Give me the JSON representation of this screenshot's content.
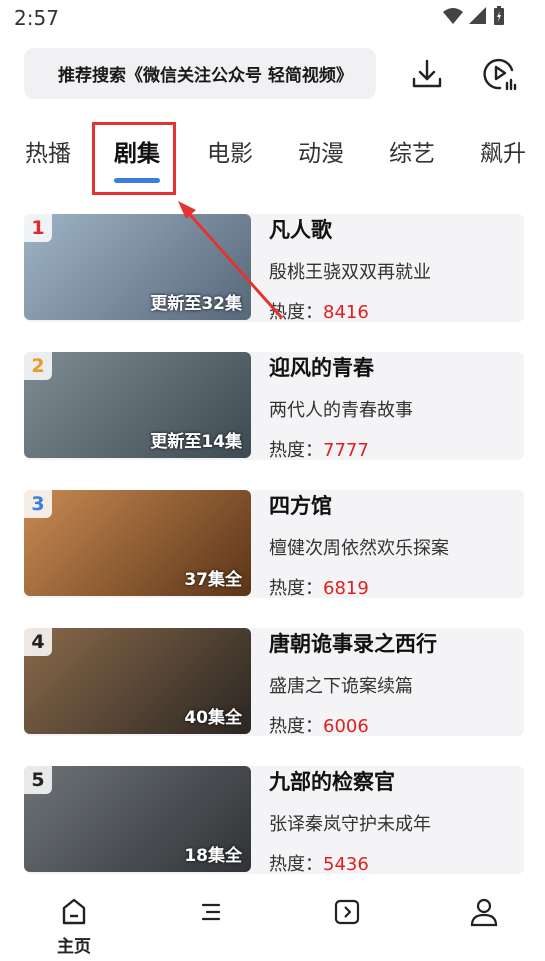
{
  "status": {
    "time": "2:57"
  },
  "search": {
    "text": "推荐搜索《微信关注公众号 轻简视频》"
  },
  "tabs": [
    {
      "label": "热播",
      "active": false
    },
    {
      "label": "剧集",
      "active": true
    },
    {
      "label": "电影",
      "active": false
    },
    {
      "label": "动漫",
      "active": false
    },
    {
      "label": "综艺",
      "active": false
    },
    {
      "label": "飙升",
      "active": false
    }
  ],
  "heat_prefix": "热度：",
  "items": [
    {
      "rank": "1",
      "rank_color": "#e02a2a",
      "episodes": "更新至32集",
      "title": "凡人歌",
      "desc": "殷桃王骁双双再就业",
      "heat": "8416",
      "thumb_colors": [
        "#9fb4c6",
        "#56687a"
      ]
    },
    {
      "rank": "2",
      "rank_color": "#e89a2a",
      "episodes": "更新至14集",
      "title": "迎风的青春",
      "desc": "两代人的青春故事",
      "heat": "7777",
      "thumb_colors": [
        "#7f8c94",
        "#3d4a52"
      ]
    },
    {
      "rank": "3",
      "rank_color": "#3b7de0",
      "episodes": "37集全",
      "title": "四方馆",
      "desc": "檀健次周依然欢乐探案",
      "heat": "6819",
      "thumb_colors": [
        "#c98b52",
        "#5a3418"
      ]
    },
    {
      "rank": "4",
      "rank_color": "#222222",
      "episodes": "40集全",
      "title": "唐朝诡事录之西行",
      "desc": "盛唐之下诡案续篇",
      "heat": "6006",
      "thumb_colors": [
        "#8a6a4a",
        "#2a2622"
      ]
    },
    {
      "rank": "5",
      "rank_color": "#222222",
      "episodes": "18集全",
      "title": "九部的检察官",
      "desc": "张译秦岚守护未成年",
      "heat": "5436",
      "thumb_colors": [
        "#6e7378",
        "#2f3336"
      ]
    }
  ],
  "bottom_nav": [
    {
      "label": "主页",
      "icon": "home-icon",
      "active": true
    },
    {
      "label": "",
      "icon": "list-icon",
      "active": false
    },
    {
      "label": "",
      "icon": "play-box-icon",
      "active": false
    },
    {
      "label": "",
      "icon": "user-icon",
      "active": false
    }
  ],
  "colors": {
    "accent": "#3b7de0",
    "highlight": "#e53333",
    "heat": "#e02020"
  }
}
